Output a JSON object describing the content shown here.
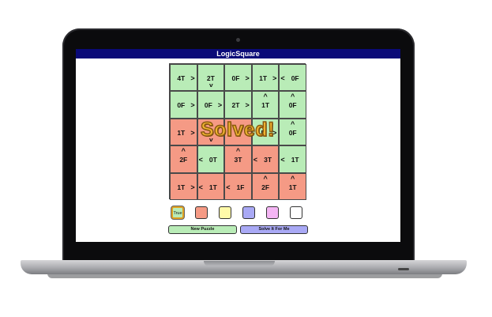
{
  "app": {
    "title": "LogicSquare"
  },
  "overlay": {
    "text": "Solved!"
  },
  "colors": {
    "green": "#b9ecb7",
    "red": "#f59a85",
    "yellow": "#fffaa9",
    "blue": "#a9a9f5",
    "pink": "#f4b5f4",
    "white": "#ffffff",
    "titlebar": "#0a0a78"
  },
  "board": {
    "rows": [
      [
        {
          "text": "4T",
          "arrow": "right",
          "color": "green"
        },
        {
          "text": "2T",
          "arrow": "down",
          "color": "green"
        },
        {
          "text": "0F",
          "arrow": "right",
          "color": "green"
        },
        {
          "text": "1T",
          "arrow": "right",
          "color": "green"
        },
        {
          "text": "0F",
          "arrow": "left",
          "color": "green"
        }
      ],
      [
        {
          "text": "0F",
          "arrow": "right",
          "color": "green"
        },
        {
          "text": "0F",
          "arrow": "right",
          "color": "green"
        },
        {
          "text": "2T",
          "arrow": "right",
          "color": "green"
        },
        {
          "text": "1T",
          "arrow": "up",
          "color": "green"
        },
        {
          "text": "0F",
          "arrow": "up",
          "color": "green"
        }
      ],
      [
        {
          "text": "1T",
          "arrow": "right",
          "color": "red"
        },
        {
          "text": "",
          "arrow": "down",
          "color": "red"
        },
        {
          "text": "",
          "arrow": "",
          "color": "red"
        },
        {
          "text": "F",
          "arrow": "right",
          "color": "green"
        },
        {
          "text": "0F",
          "arrow": "up",
          "color": "green"
        }
      ],
      [
        {
          "text": "2F",
          "arrow": "up",
          "color": "red"
        },
        {
          "text": "0T",
          "arrow": "left",
          "color": "green"
        },
        {
          "text": "3T",
          "arrow": "up",
          "color": "red"
        },
        {
          "text": "3T",
          "arrow": "left",
          "color": "red"
        },
        {
          "text": "1T",
          "arrow": "left",
          "color": "green"
        }
      ],
      [
        {
          "text": "1T",
          "arrow": "right",
          "color": "red"
        },
        {
          "text": "1T",
          "arrow": "left",
          "color": "red"
        },
        {
          "text": "1F",
          "arrow": "left",
          "color": "red"
        },
        {
          "text": "2F",
          "arrow": "up",
          "color": "red"
        },
        {
          "text": "1T",
          "arrow": "up",
          "color": "red"
        }
      ]
    ]
  },
  "palette": [
    {
      "label": "True",
      "color": "green",
      "selected": true
    },
    {
      "label": "",
      "color": "red",
      "selected": false
    },
    {
      "label": "",
      "color": "yellow",
      "selected": false
    },
    {
      "label": "",
      "color": "blue",
      "selected": false
    },
    {
      "label": "",
      "color": "pink",
      "selected": false
    },
    {
      "label": "",
      "color": "white",
      "selected": false
    }
  ],
  "buttons": {
    "new_puzzle": "New Puzzle",
    "solve_it": "Solve It For Me"
  }
}
